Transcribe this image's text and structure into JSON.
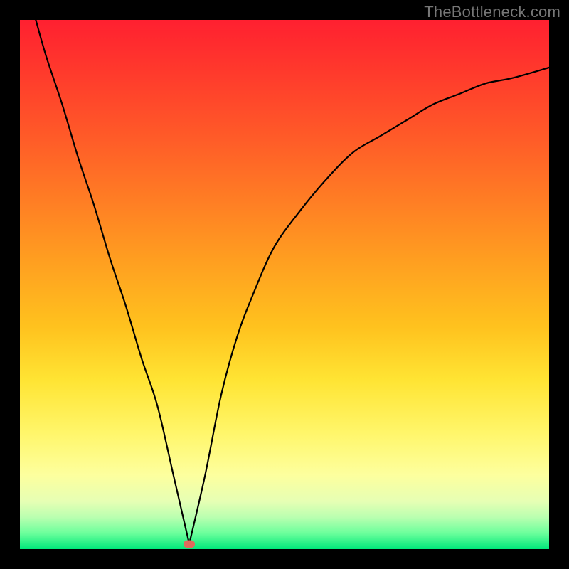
{
  "watermark": "TheBottleneck.com",
  "colors": {
    "frame": "#000000",
    "grad_top": "#ff2030",
    "grad_bottom": "#00e97a",
    "curve": "#000000",
    "marker": "#e06a5c"
  },
  "chart_data": {
    "type": "line",
    "title": "",
    "xlabel": "",
    "ylabel": "",
    "xlim": [
      0,
      100
    ],
    "ylim": [
      0,
      100
    ],
    "grid": false,
    "legend": false,
    "note": "Axis numeric ranges are normalized percentages; no tick labels are shown in the image.",
    "min_point": {
      "x": 32,
      "y": 1
    },
    "series": [
      {
        "name": "curve",
        "x": [
          3,
          5,
          8,
          11,
          14,
          17,
          20,
          23,
          26,
          29,
          32,
          35,
          38,
          41,
          44,
          48,
          53,
          58,
          63,
          68,
          73,
          78,
          83,
          88,
          93,
          100
        ],
        "y": [
          100,
          93,
          84,
          74,
          65,
          55,
          46,
          36,
          27,
          14,
          1,
          14,
          29,
          40,
          48,
          57,
          64,
          70,
          75,
          78,
          81,
          84,
          86,
          88,
          89,
          91
        ]
      }
    ]
  }
}
